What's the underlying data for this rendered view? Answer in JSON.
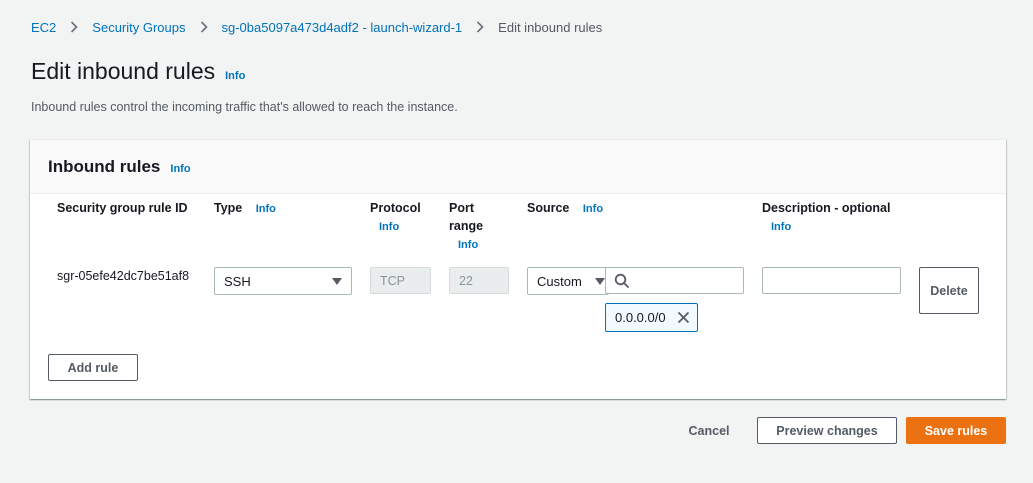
{
  "breadcrumb": {
    "items": [
      "EC2",
      "Security Groups",
      "sg-0ba5097a473d4adf2 - launch-wizard-1"
    ],
    "current": "Edit inbound rules"
  },
  "page": {
    "title": "Edit inbound rules",
    "info": "Info",
    "description": "Inbound rules control the incoming traffic that's allowed to reach the instance."
  },
  "panel": {
    "title": "Inbound rules",
    "info": "Info",
    "columns": {
      "rule_id": "Security group rule ID",
      "type": "Type",
      "protocol": "Protocol",
      "port_line1": "Port",
      "port_line2": "range",
      "source": "Source",
      "description": "Description - optional",
      "info": "Info"
    },
    "rule": {
      "id": "sgr-05efe42dc7be51af8",
      "type": "SSH",
      "protocol": "TCP",
      "port": "22",
      "source_mode": "Custom",
      "source_search_value": "",
      "source_token": "0.0.0.0/0",
      "description_value": "",
      "delete_label": "Delete"
    },
    "add_rule_label": "Add rule"
  },
  "footer": {
    "cancel_label": "Cancel",
    "preview_label": "Preview changes",
    "save_label": "Save rules"
  },
  "colors": {
    "link": "#0073bb",
    "primary": "#ec7211",
    "background": "#f2f3f3"
  },
  "icons": [
    "chevron-right-icon",
    "caret-down-icon",
    "search-icon",
    "close-icon"
  ]
}
